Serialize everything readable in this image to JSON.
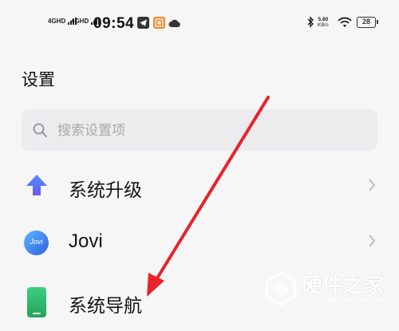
{
  "status_bar": {
    "signal1": "4GHD",
    "signal2": "4GHD",
    "time": "09:54",
    "net_speed_value": "5.80",
    "net_speed_unit": "KB/s",
    "battery": "28",
    "icons": [
      "signal-icon",
      "signal-icon",
      "telegram-icon",
      "app-notification-icon",
      "cloud-icon",
      "bluetooth-icon",
      "wifi-icon",
      "battery-icon"
    ]
  },
  "header": {
    "title": "设置"
  },
  "search": {
    "placeholder": "搜索设置项"
  },
  "settings": [
    {
      "label": "系统升级",
      "icon": "system-update-icon",
      "color": "#4a7cf0",
      "chevron": true
    },
    {
      "label": "Jovi",
      "icon": "jovi-icon",
      "icon_text": "Jovi",
      "color": "#3a6fe0",
      "chevron": true
    },
    {
      "label": "系统导航",
      "icon": "system-navigation-icon",
      "color": "#2fb86a",
      "chevron": false
    }
  ],
  "watermark": {
    "text": "硬件之家",
    "subtext": "YING JIAN ZHI JIA.COM"
  },
  "colors": {
    "background": "#f6f6f7",
    "search_bg": "#ececee",
    "annotation_arrow": "#e8232a"
  }
}
